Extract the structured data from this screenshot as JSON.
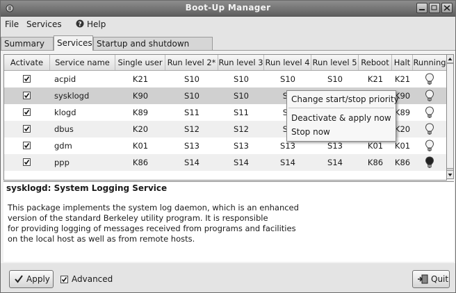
{
  "window": {
    "title": "Boot-Up Manager"
  },
  "menubar": {
    "file": "File",
    "services": "Services",
    "help": "Help"
  },
  "tabs": [
    "Summary",
    "Services",
    "Startup and shutdown scripts"
  ],
  "table": {
    "columns": [
      "Activate",
      "Service name",
      "Single user",
      "Run level 2*",
      "Run level 3",
      "Run level 4",
      "Run level 5",
      "Reboot",
      "Halt",
      "Running"
    ],
    "rows": [
      {
        "activate": true,
        "name": "acpid",
        "single": "K21",
        "rl2": "S10",
        "rl3": "S10",
        "rl4": "S10",
        "rl5": "S10",
        "reboot": "K21",
        "halt": "K21",
        "running": false
      },
      {
        "activate": true,
        "name": "sysklogd",
        "single": "K90",
        "rl2": "S10",
        "rl3": "S10",
        "rl4": "S1",
        "rl5": "",
        "reboot": "",
        "halt": "K90",
        "running": false
      },
      {
        "activate": true,
        "name": "klogd",
        "single": "K89",
        "rl2": "S11",
        "rl3": "S11",
        "rl4": "S1",
        "rl5": "",
        "reboot": "",
        "halt": "K89",
        "running": false
      },
      {
        "activate": true,
        "name": "dbus",
        "single": "K20",
        "rl2": "S12",
        "rl3": "S12",
        "rl4": "S1",
        "rl5": "",
        "reboot": "",
        "halt": "K20",
        "running": false
      },
      {
        "activate": true,
        "name": "gdm",
        "single": "K01",
        "rl2": "S13",
        "rl3": "S13",
        "rl4": "S13",
        "rl5": "S13",
        "reboot": "K01",
        "halt": "K01",
        "running": false
      },
      {
        "activate": true,
        "name": "ppp",
        "single": "K86",
        "rl2": "S14",
        "rl3": "S14",
        "rl4": "S14",
        "rl5": "S14",
        "reboot": "K86",
        "halt": "K86",
        "running": true
      }
    ]
  },
  "context_menu": {
    "items": [
      "Change start/stop priority",
      "Deactivate & apply now",
      "Stop now"
    ]
  },
  "description": {
    "heading": "sysklogd: System Logging Service",
    "lines": [
      "This package implements the system log daemon, which is an enhanced",
      "version of the standard Berkeley utility program. It is responsible",
      "for providing logging of messages received from programs and facilities",
      "on the local host as well as from remote hosts."
    ]
  },
  "footer": {
    "apply": "Apply",
    "advanced": "Advanced",
    "advanced_checked": true,
    "quit": "Quit"
  },
  "colors": {
    "selected_row": "#d0d0d0",
    "titlebar": "#6f6f6f"
  }
}
